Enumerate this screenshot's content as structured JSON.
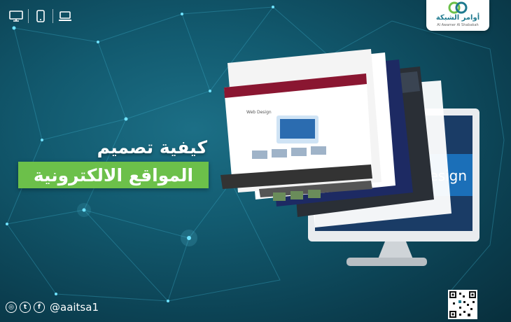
{
  "title": {
    "line1": "كيفية تصميم",
    "line2": "المواقع الالكترونية"
  },
  "brand": {
    "name": "أوامر الشبكة",
    "tagline": "Al Awamer Al Shabakah",
    "accent_color": "#6cc04a",
    "brand_color": "#1f7a8f"
  },
  "top_icons": [
    "computer-icon",
    "mobile-icon",
    "laptop-icon"
  ],
  "social": {
    "icons": [
      "instagram-icon",
      "twitter-icon",
      "facebook-icon"
    ],
    "handle": "@aaitsa1"
  },
  "mockup": {
    "screen_text": "Design",
    "inner_heading": "Web Design"
  }
}
